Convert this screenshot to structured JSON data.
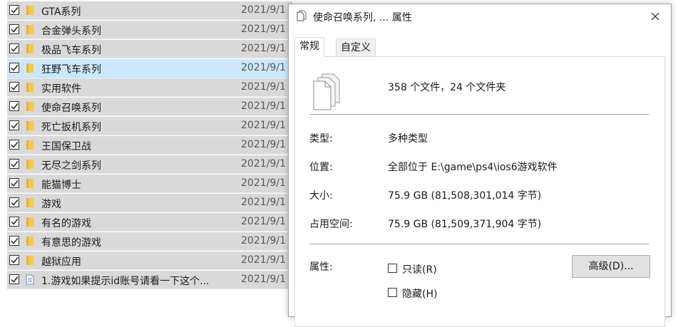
{
  "file_list": {
    "rows": [
      {
        "name": "GTA系列",
        "date": "2021/9/1",
        "icon": "folder-icon",
        "checked": true
      },
      {
        "name": "合金弹头系列",
        "date": "2021/9/1",
        "icon": "folder-icon",
        "checked": true
      },
      {
        "name": "极品飞车系列",
        "date": "2021/9/1",
        "icon": "folder-icon",
        "checked": true
      },
      {
        "name": "狂野飞车系列",
        "date": "2021/9/1",
        "icon": "folder-icon",
        "checked": true
      },
      {
        "name": "实用软件",
        "date": "2021/9/1",
        "icon": "folder-icon",
        "checked": true
      },
      {
        "name": "使命召唤系列",
        "date": "2021/9/1",
        "icon": "folder-icon",
        "checked": true
      },
      {
        "name": "死亡扳机系列",
        "date": "2021/9/1",
        "icon": "folder-icon",
        "checked": true
      },
      {
        "name": "王国保卫战",
        "date": "2021/9/1",
        "icon": "folder-icon",
        "checked": true
      },
      {
        "name": "无尽之剑系列",
        "date": "2021/9/1",
        "icon": "folder-icon",
        "checked": true
      },
      {
        "name": "能猫博士",
        "date": "2021/9/1",
        "icon": "folder-icon",
        "checked": true
      },
      {
        "name": "游戏",
        "date": "2021/9/1",
        "icon": "folder-icon",
        "checked": true
      },
      {
        "name": "有名的游戏",
        "date": "2021/9/1",
        "icon": "folder-icon",
        "checked": true
      },
      {
        "name": "有意思的游戏",
        "date": "2021/9/1",
        "icon": "folder-icon",
        "checked": true
      },
      {
        "name": "越狱应用",
        "date": "2021/9/1",
        "icon": "folder-icon",
        "checked": true
      },
      {
        "name": "1.游戏如果提示id账号请看一下这个...",
        "date": "2021/9/1",
        "icon": "document-icon",
        "checked": true
      }
    ]
  },
  "dialog": {
    "title": "使命召唤系列, ... 属性",
    "tabs": [
      {
        "label": "常规",
        "active": true
      },
      {
        "label": "自定义",
        "active": false
      }
    ],
    "summary": "358 个文件，24 个文件夹",
    "properties": [
      {
        "label": "类型:",
        "value": "多种类型"
      },
      {
        "label": "位置:",
        "value": "全部位于 E:\\game\\ps4\\ios6游戏软件"
      },
      {
        "label": "大小:",
        "value": "75.9 GB (81,508,301,014 字节)"
      },
      {
        "label": "占用空间:",
        "value": "75.9 GB (81,509,371,904 字节)"
      }
    ],
    "attributes_label": "属性:",
    "attributes": [
      {
        "label": "只读(R)",
        "checked": false
      },
      {
        "label": "隐藏(H)",
        "checked": false
      }
    ],
    "advanced_button": "高级(D)..."
  },
  "colors": {
    "row_selected": "#d9d9d9",
    "row_hover": "#cce8ff",
    "folder": "#f7c948",
    "button_face": "#e1e1e1"
  }
}
